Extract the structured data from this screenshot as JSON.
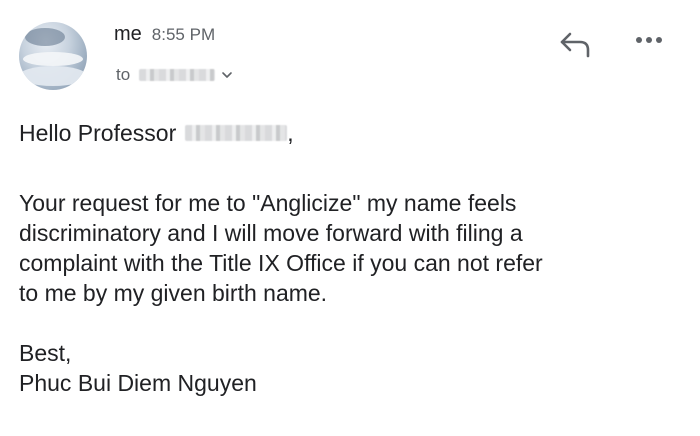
{
  "header": {
    "sender": "me",
    "time": "8:55 PM",
    "to_label": "to"
  },
  "icons": {
    "reply": "reply-arrow-icon",
    "more": "more-dots-icon",
    "expand": "chevron-down-icon"
  },
  "message": {
    "greeting": "Hello Professor",
    "greeting_punct": ",",
    "paragraph": [
      "Your request for me to \"Anglicize\" my name feels",
      "discriminatory and I will move forward with filing a",
      "complaint with the Title IX Office if you can not refer",
      "to me by my given birth name."
    ],
    "closing": "Best,",
    "signature": "Phuc Bui Diem Nguyen"
  }
}
